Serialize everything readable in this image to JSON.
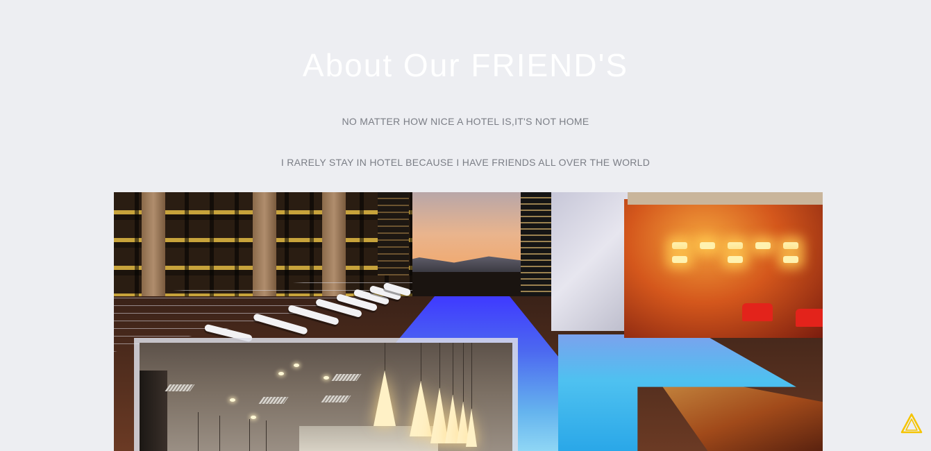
{
  "about": {
    "title": "About Our FRIEND'S",
    "line1": "NO MATTER HOW NICE A HOTEL IS,IT'S NOT HOME",
    "line2": "I RARELY STAY IN HOTEL BECAUSE I HAVE FRIENDS ALL OVER THE WORLD"
  },
  "images": {
    "main": "rooftop-pool-photo",
    "inset": "restaurant-interior-photo"
  },
  "icons": {
    "warning": "warning-triangle-icon"
  },
  "colors": {
    "background": "#edeef2",
    "title": "#ffffff",
    "text": "#7a7d85",
    "warning": "#f5c400"
  }
}
